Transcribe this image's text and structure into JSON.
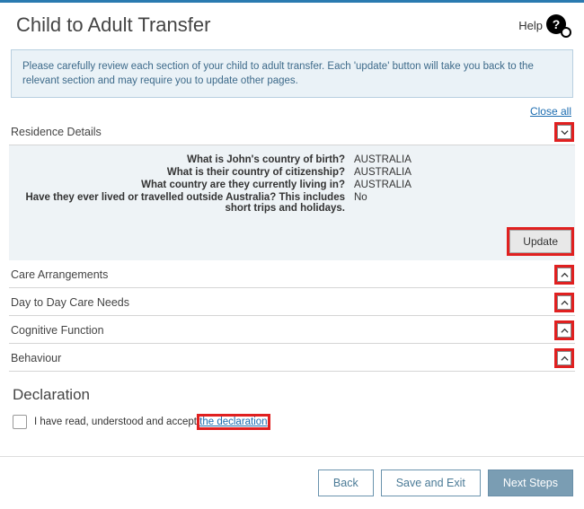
{
  "header": {
    "title": "Child to Adult Transfer",
    "help_label": "Help"
  },
  "info_box": "Please carefully review each section of your child to adult transfer. Each 'update' button will take you back to the relevant section and may require you to update other pages.",
  "close_all": "Close all",
  "residence": {
    "title": "Residence Details",
    "q1": "What is John's country of birth?",
    "a1": "AUSTRALIA",
    "q2": "What is their country of citizenship?",
    "a2": "AUSTRALIA",
    "q3": "What country are they currently living in?",
    "a3": "AUSTRALIA",
    "q4": "Have they ever lived or travelled outside Australia? This includes short trips and holidays.",
    "a4": "No",
    "update_label": "Update"
  },
  "sections": {
    "care": "Care Arrangements",
    "daytoday": "Day to Day Care Needs",
    "cognitive": "Cognitive Function",
    "behaviour": "Behaviour"
  },
  "declaration": {
    "heading": "Declaration",
    "text_prefix": "I have read, understood and accept ",
    "link_text": "the declaration"
  },
  "footer": {
    "back": "Back",
    "save": "Save and Exit",
    "next": "Next Steps"
  }
}
